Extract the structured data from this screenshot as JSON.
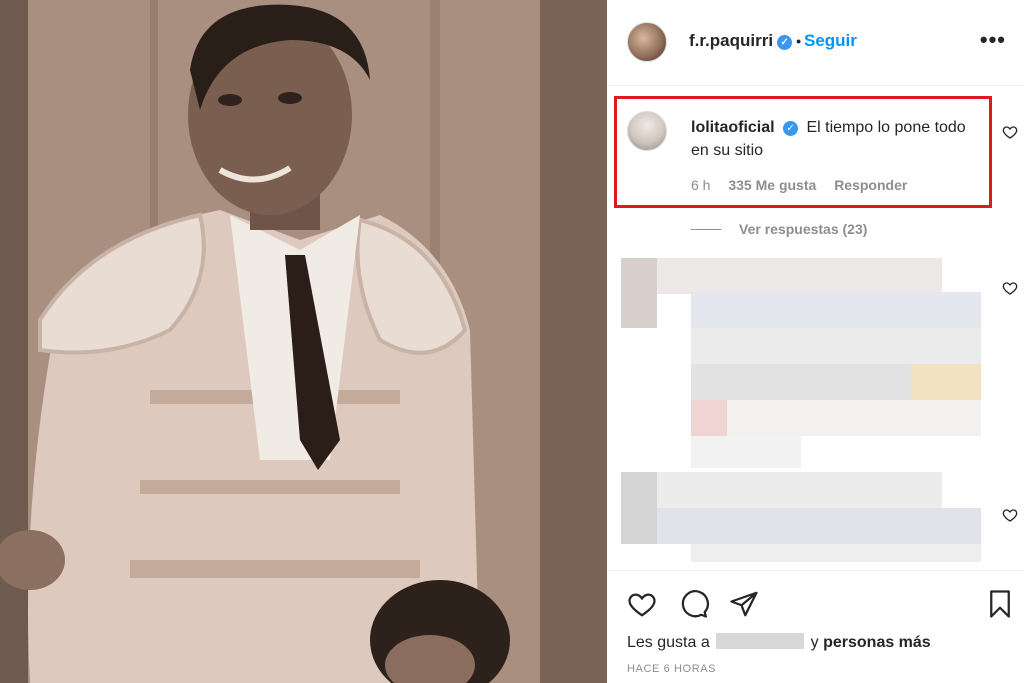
{
  "post": {
    "username": "f.r.paquirri",
    "verified_icon": "verified-badge-icon",
    "separator": "•",
    "follow_label": "Seguir",
    "more_icon": "more-options-icon",
    "more_glyph": "•••"
  },
  "comment": {
    "username": "lolitaoficial",
    "text": "El tiempo lo pone todo en su sitio",
    "age": "6 h",
    "likes": "335 Me gusta",
    "reply_label": "Responder",
    "view_replies": "Ver respuestas (23)",
    "highlight_color": "#e0191f"
  },
  "actions": {
    "like_icon": "heart-icon",
    "comment_icon": "comment-icon",
    "share_icon": "share-icon",
    "save_icon": "bookmark-icon",
    "likes_prefix": "Les gusta a",
    "likes_suffix": "y",
    "likes_more": "personas más",
    "timestamp": "HACE 6 HORAS"
  },
  "colors": {
    "accent": "#0095f6",
    "verified": "#3897f0",
    "muted": "#8e8e8e",
    "text": "#262626"
  }
}
